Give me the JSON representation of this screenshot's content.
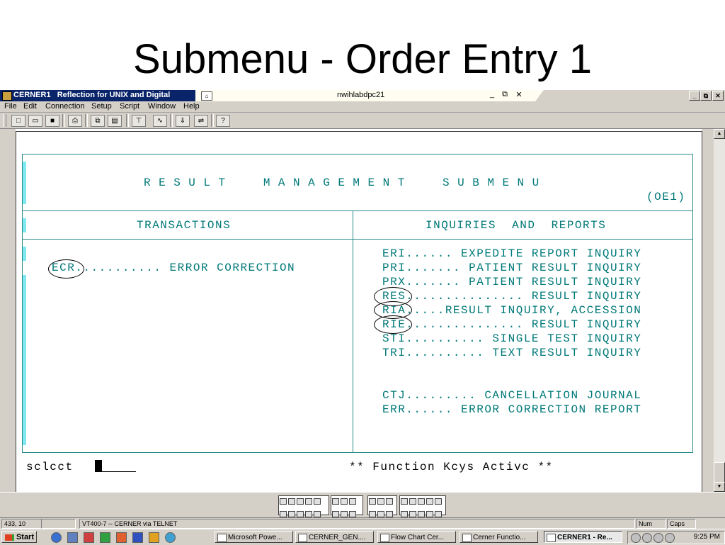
{
  "slide": {
    "title": "Submenu - Order Entry 1"
  },
  "window": {
    "app_title": "CERNER1   Reflection for UNIX and Digital",
    "host": "nwihlabdpc21",
    "mid_minimize": "_",
    "mid_restore": "⧉",
    "mid_close": "✕",
    "minimize": "_",
    "restore": "⧉",
    "close": "✕"
  },
  "menu": {
    "items": [
      "File",
      "Edit",
      "Connection",
      "Setup",
      "Script",
      "Window",
      "Help"
    ]
  },
  "toolbar": {
    "icons": [
      "new-icon",
      "open-icon",
      "save-icon",
      "print-icon",
      "copy-icon",
      "paste-icon",
      "connect-icon",
      "macro-icon",
      "transfer-icon",
      "network-icon",
      "help-icon"
    ]
  },
  "terminal": {
    "menu_title": "RESULT  MANAGEMENT  SUBMENU",
    "menu_code": "(OE1)",
    "left_header": "TRANSACTIONS",
    "right_header": "INQUIRIES  AND  REPORTS",
    "left_items": [
      {
        "code": "ECR",
        "text": "ECR........... ERROR CORRECTION"
      }
    ],
    "right_items": [
      {
        "code": "ERI",
        "text": "ERI...... EXPEDITE REPORT INQUIRY"
      },
      {
        "code": "PRI",
        "text": "PRI....... PATIENT RESULT INQUIRY"
      },
      {
        "code": "PRX",
        "text": "PRX....... PATIENT RESULT INQUIRY"
      },
      {
        "code": "RES",
        "text": "RES............... RESULT INQUIRY"
      },
      {
        "code": "RIA",
        "text": "RIA.....RESULT INQUIRY, ACCESSION"
      },
      {
        "code": "RIE",
        "text": "RIE............... RESULT INQUIRY"
      },
      {
        "code": "STI",
        "text": "STI.......... SINGLE TEST INQUIRY"
      },
      {
        "code": "TRI",
        "text": "TRI.......... TEXT RESULT INQUIRY"
      },
      {
        "code": "CTJ",
        "text": "CTJ......... CANCELLATION JOURNAL"
      },
      {
        "code": "ERR",
        "text": "ERR...... ERROR CORRECTION REPORT"
      }
    ],
    "select_label": "sclcct",
    "function_keys": "** Function Kcys Activc **"
  },
  "status": {
    "cursor_pos": "433, 10",
    "connection": "VT400-7 -- CERNER via TELNET",
    "num": "Num",
    "caps": "Caps"
  },
  "taskbar": {
    "start": "Start",
    "tasks": [
      "Microsoft Powe...",
      "CERNER_GEN....",
      "Flow Chart Cer...",
      "Cerner Functio...",
      "CERNER1 - Re..."
    ],
    "clock": "9:25 PM"
  },
  "colors": {
    "terminal_text": "#007878",
    "titlebar": "#0a246a",
    "chrome": "#d4d0c8"
  }
}
